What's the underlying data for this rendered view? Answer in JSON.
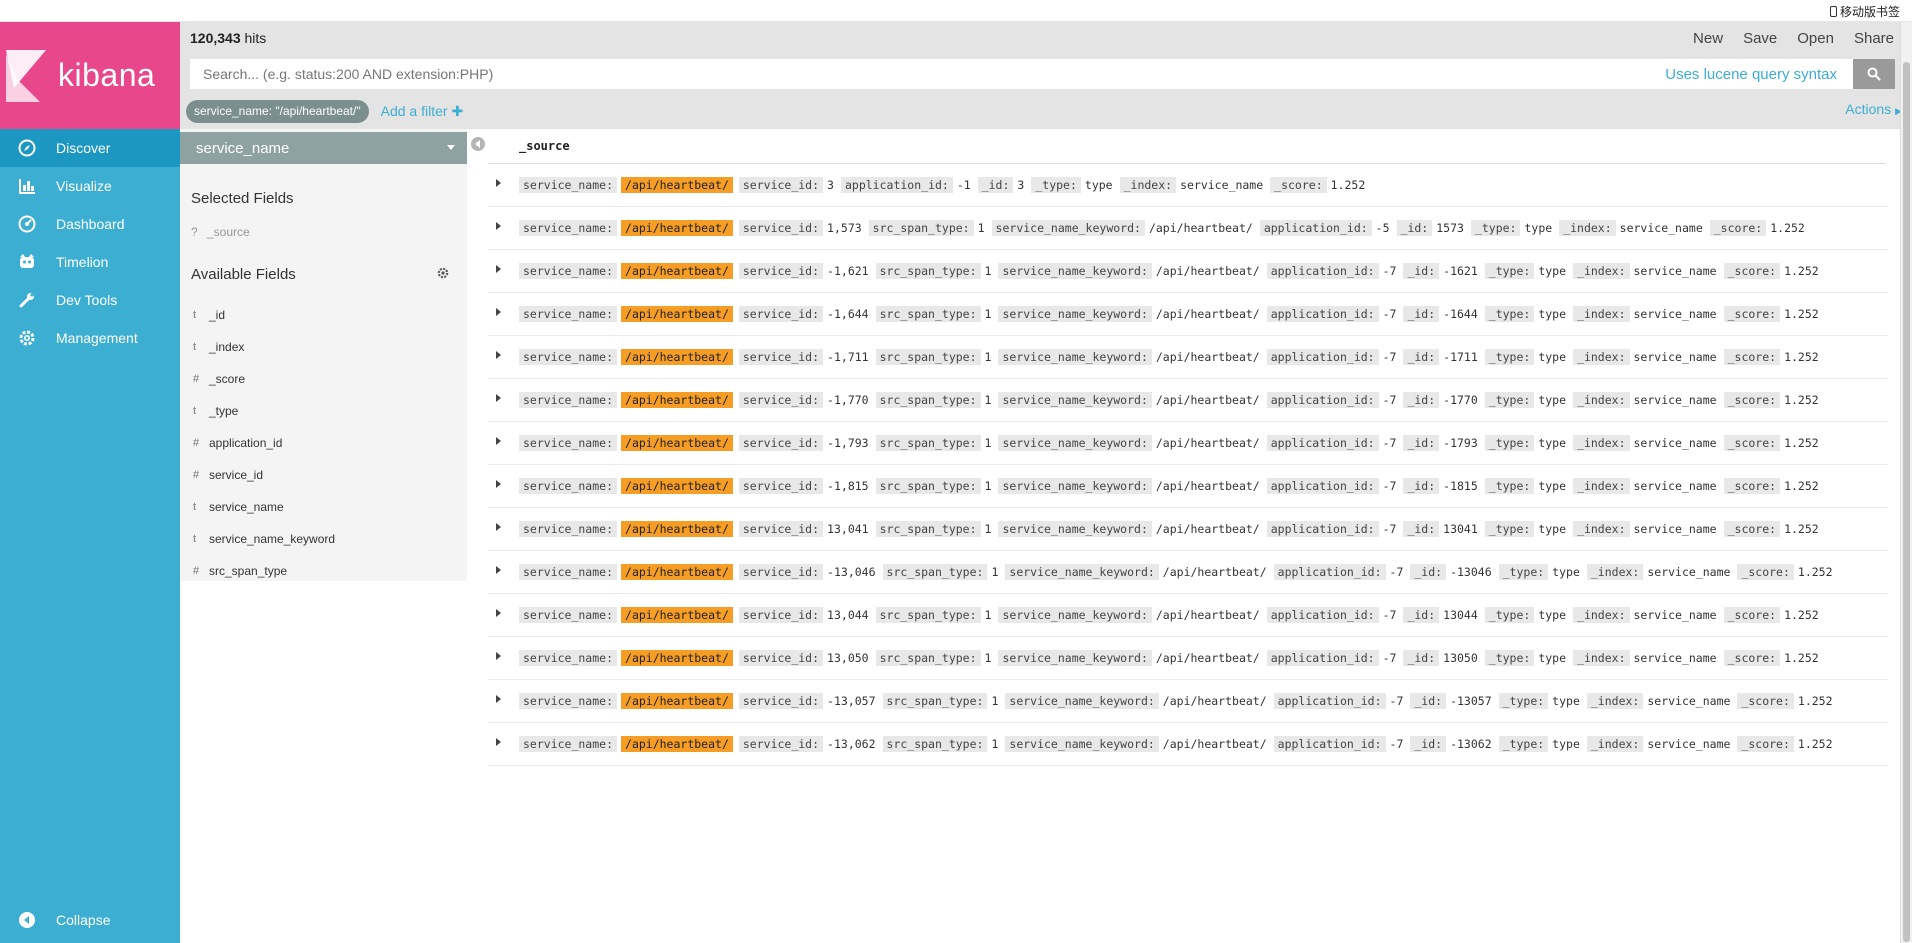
{
  "browser": {
    "mobile_bookmark": "移动版书签"
  },
  "app": {
    "logo_text": "kibana"
  },
  "sidebar": {
    "items": [
      {
        "label": "Discover",
        "icon": "compass-icon",
        "active": true
      },
      {
        "label": "Visualize",
        "icon": "bar-chart-icon",
        "active": false
      },
      {
        "label": "Dashboard",
        "icon": "dashboard-icon",
        "active": false
      },
      {
        "label": "Timelion",
        "icon": "timelion-icon",
        "active": false
      },
      {
        "label": "Dev Tools",
        "icon": "wrench-icon",
        "active": false
      },
      {
        "label": "Management",
        "icon": "gear-icon",
        "active": false
      }
    ],
    "collapse_label": "Collapse"
  },
  "header": {
    "hits_count": "120,343",
    "hits_label": " hits",
    "actions": [
      "New",
      "Save",
      "Open",
      "Share"
    ],
    "search_placeholder": "Search... (e.g. status:200 AND extension:PHP)",
    "lucene_link": "Uses lucene query syntax",
    "filter_pill": "service_name: \"/api/heartbeat/\"",
    "add_filter": "Add a filter",
    "actions_link": "Actions"
  },
  "fields_panel": {
    "index_pattern": "service_name",
    "selected_heading": "Selected Fields",
    "source_field": {
      "type": "?",
      "name": "_source"
    },
    "available_heading": "Available Fields",
    "fields": [
      {
        "type": "t",
        "name": "_id"
      },
      {
        "type": "t",
        "name": "_index"
      },
      {
        "type": "#",
        "name": "_score"
      },
      {
        "type": "t",
        "name": "_type"
      },
      {
        "type": "#",
        "name": "application_id"
      },
      {
        "type": "#",
        "name": "service_id"
      },
      {
        "type": "t",
        "name": "service_name"
      },
      {
        "type": "t",
        "name": "service_name_keyword"
      },
      {
        "type": "#",
        "name": "src_span_type"
      }
    ]
  },
  "table": {
    "column_header": "_source",
    "rows": [
      [
        [
          "service_name:",
          "/api/heartbeat/",
          "hl"
        ],
        [
          "service_id:",
          "3"
        ],
        [
          "application_id:",
          "-1"
        ],
        [
          "_id:",
          "3"
        ],
        [
          "_type:",
          "type"
        ],
        [
          "_index:",
          "service_name"
        ],
        [
          "_score:",
          "1.252"
        ]
      ],
      [
        [
          "service_name:",
          "/api/heartbeat/",
          "hl"
        ],
        [
          "service_id:",
          "1,573"
        ],
        [
          "src_span_type:",
          "1"
        ],
        [
          "service_name_keyword:",
          "/api/heartbeat/"
        ],
        [
          "application_id:",
          "-5"
        ],
        [
          "_id:",
          "1573"
        ],
        [
          "_type:",
          "type"
        ],
        [
          "_index:",
          "service_name"
        ],
        [
          "_score:",
          "1.252"
        ]
      ],
      [
        [
          "service_name:",
          "/api/heartbeat/",
          "hl"
        ],
        [
          "service_id:",
          "-1,621"
        ],
        [
          "src_span_type:",
          "1"
        ],
        [
          "service_name_keyword:",
          "/api/heartbeat/"
        ],
        [
          "application_id:",
          "-7"
        ],
        [
          "_id:",
          "-1621"
        ],
        [
          "_type:",
          "type"
        ],
        [
          "_index:",
          "service_name"
        ],
        [
          "_score:",
          "1.252"
        ]
      ],
      [
        [
          "service_name:",
          "/api/heartbeat/",
          "hl"
        ],
        [
          "service_id:",
          "-1,644"
        ],
        [
          "src_span_type:",
          "1"
        ],
        [
          "service_name_keyword:",
          "/api/heartbeat/"
        ],
        [
          "application_id:",
          "-7"
        ],
        [
          "_id:",
          "-1644"
        ],
        [
          "_type:",
          "type"
        ],
        [
          "_index:",
          "service_name"
        ],
        [
          "_score:",
          "1.252"
        ]
      ],
      [
        [
          "service_name:",
          "/api/heartbeat/",
          "hl"
        ],
        [
          "service_id:",
          "-1,711"
        ],
        [
          "src_span_type:",
          "1"
        ],
        [
          "service_name_keyword:",
          "/api/heartbeat/"
        ],
        [
          "application_id:",
          "-7"
        ],
        [
          "_id:",
          "-1711"
        ],
        [
          "_type:",
          "type"
        ],
        [
          "_index:",
          "service_name"
        ],
        [
          "_score:",
          "1.252"
        ]
      ],
      [
        [
          "service_name:",
          "/api/heartbeat/",
          "hl"
        ],
        [
          "service_id:",
          "-1,770"
        ],
        [
          "src_span_type:",
          "1"
        ],
        [
          "service_name_keyword:",
          "/api/heartbeat/"
        ],
        [
          "application_id:",
          "-7"
        ],
        [
          "_id:",
          "-1770"
        ],
        [
          "_type:",
          "type"
        ],
        [
          "_index:",
          "service_name"
        ],
        [
          "_score:",
          "1.252"
        ]
      ],
      [
        [
          "service_name:",
          "/api/heartbeat/",
          "hl"
        ],
        [
          "service_id:",
          "-1,793"
        ],
        [
          "src_span_type:",
          "1"
        ],
        [
          "service_name_keyword:",
          "/api/heartbeat/"
        ],
        [
          "application_id:",
          "-7"
        ],
        [
          "_id:",
          "-1793"
        ],
        [
          "_type:",
          "type"
        ],
        [
          "_index:",
          "service_name"
        ],
        [
          "_score:",
          "1.252"
        ]
      ],
      [
        [
          "service_name:",
          "/api/heartbeat/",
          "hl"
        ],
        [
          "service_id:",
          "-1,815"
        ],
        [
          "src_span_type:",
          "1"
        ],
        [
          "service_name_keyword:",
          "/api/heartbeat/"
        ],
        [
          "application_id:",
          "-7"
        ],
        [
          "_id:",
          "-1815"
        ],
        [
          "_type:",
          "type"
        ],
        [
          "_index:",
          "service_name"
        ],
        [
          "_score:",
          "1.252"
        ]
      ],
      [
        [
          "service_name:",
          "/api/heartbeat/",
          "hl"
        ],
        [
          "service_id:",
          "13,041"
        ],
        [
          "src_span_type:",
          "1"
        ],
        [
          "service_name_keyword:",
          "/api/heartbeat/"
        ],
        [
          "application_id:",
          "-7"
        ],
        [
          "_id:",
          "13041"
        ],
        [
          "_type:",
          "type"
        ],
        [
          "_index:",
          "service_name"
        ],
        [
          "_score:",
          "1.252"
        ]
      ],
      [
        [
          "service_name:",
          "/api/heartbeat/",
          "hl"
        ],
        [
          "service_id:",
          "-13,046"
        ],
        [
          "src_span_type:",
          "1"
        ],
        [
          "service_name_keyword:",
          "/api/heartbeat/"
        ],
        [
          "application_id:",
          "-7"
        ],
        [
          "_id:",
          "-13046"
        ],
        [
          "_type:",
          "type"
        ],
        [
          "_index:",
          "service_name"
        ],
        [
          "_score:",
          "1.252"
        ]
      ],
      [
        [
          "service_name:",
          "/api/heartbeat/",
          "hl"
        ],
        [
          "service_id:",
          "13,044"
        ],
        [
          "src_span_type:",
          "1"
        ],
        [
          "service_name_keyword:",
          "/api/heartbeat/"
        ],
        [
          "application_id:",
          "-7"
        ],
        [
          "_id:",
          "13044"
        ],
        [
          "_type:",
          "type"
        ],
        [
          "_index:",
          "service_name"
        ],
        [
          "_score:",
          "1.252"
        ]
      ],
      [
        [
          "service_name:",
          "/api/heartbeat/",
          "hl"
        ],
        [
          "service_id:",
          "13,050"
        ],
        [
          "src_span_type:",
          "1"
        ],
        [
          "service_name_keyword:",
          "/api/heartbeat/"
        ],
        [
          "application_id:",
          "-7"
        ],
        [
          "_id:",
          "13050"
        ],
        [
          "_type:",
          "type"
        ],
        [
          "_index:",
          "service_name"
        ],
        [
          "_score:",
          "1.252"
        ]
      ],
      [
        [
          "service_name:",
          "/api/heartbeat/",
          "hl"
        ],
        [
          "service_id:",
          "-13,057"
        ],
        [
          "src_span_type:",
          "1"
        ],
        [
          "service_name_keyword:",
          "/api/heartbeat/"
        ],
        [
          "application_id:",
          "-7"
        ],
        [
          "_id:",
          "-13057"
        ],
        [
          "_type:",
          "type"
        ],
        [
          "_index:",
          "service_name"
        ],
        [
          "_score:",
          "1.252"
        ]
      ],
      [
        [
          "service_name:",
          "/api/heartbeat/",
          "hl"
        ],
        [
          "service_id:",
          "-13,062"
        ],
        [
          "src_span_type:",
          "1"
        ],
        [
          "service_name_keyword:",
          "/api/heartbeat/"
        ],
        [
          "application_id:",
          "-7"
        ],
        [
          "_id:",
          "-13062"
        ],
        [
          "_type:",
          "type"
        ],
        [
          "_index:",
          "service_name"
        ],
        [
          "_score:",
          "1.252"
        ]
      ]
    ]
  },
  "colors": {
    "sidebar": "#3caed2",
    "logo": "#e8488b",
    "active_nav": "#1c97c2",
    "highlight": "#f59d24",
    "link": "#3caed2"
  }
}
